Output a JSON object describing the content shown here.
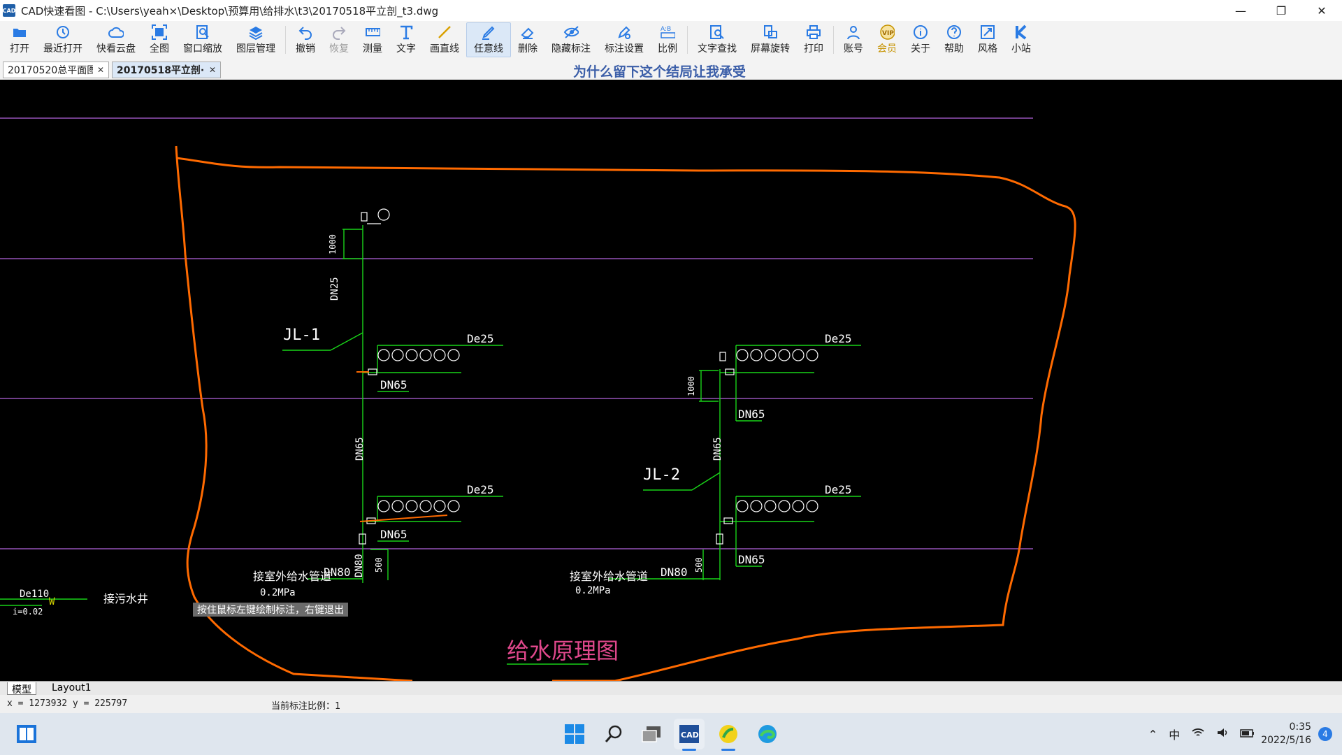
{
  "window": {
    "title": "CAD快速看图 - C:\\Users\\yeah×\\Desktop\\预算用\\给排水\\t3\\20170518平立剖_t3.dwg",
    "icon_text": "CAD"
  },
  "toolbar": {
    "items": [
      {
        "label": "打开",
        "icon": "folder-open-icon"
      },
      {
        "label": "最近打开",
        "icon": "history-icon"
      },
      {
        "label": "快看云盘",
        "icon": "cloud-icon"
      },
      {
        "label": "全图",
        "icon": "fit-all-icon"
      },
      {
        "label": "窗口缩放",
        "icon": "window-zoom-icon"
      },
      {
        "label": "图层管理",
        "icon": "layers-icon"
      },
      {
        "label": "撤销",
        "icon": "undo-icon"
      },
      {
        "label": "恢复",
        "icon": "redo-icon"
      },
      {
        "label": "测量",
        "icon": "ruler-icon"
      },
      {
        "label": "文字",
        "icon": "text-icon"
      },
      {
        "label": "画直线",
        "icon": "line-icon"
      },
      {
        "label": "任意线",
        "icon": "freehand-icon"
      },
      {
        "label": "删除",
        "icon": "eraser-icon"
      },
      {
        "label": "隐藏标注",
        "icon": "eye-icon"
      },
      {
        "label": "标注设置",
        "icon": "annotation-settings-icon"
      },
      {
        "label": "比例",
        "icon": "scale-icon"
      },
      {
        "label": "文字查找",
        "icon": "text-search-icon"
      },
      {
        "label": "屏幕旋转",
        "icon": "rotate-icon"
      },
      {
        "label": "打印",
        "icon": "print-icon"
      },
      {
        "label": "账号",
        "icon": "user-icon"
      },
      {
        "label": "会员",
        "icon": "vip-icon"
      },
      {
        "label": "关于",
        "icon": "info-icon"
      },
      {
        "label": "帮助",
        "icon": "help-icon"
      },
      {
        "label": "风格",
        "icon": "style-icon"
      },
      {
        "label": "小站",
        "icon": "k-icon"
      }
    ],
    "active_item": "任意线",
    "disabled_item": "恢复",
    "vip_badge": "VIP"
  },
  "tabs": [
    {
      "label": "20170520总平面图",
      "active": false
    },
    {
      "label": "20170518平立剖···",
      "active": true
    }
  ],
  "subtitle": "为什么留下这个结局让我承受",
  "drawing": {
    "labels": {
      "jl1": "JL-1",
      "jl2": "JL-2",
      "de25": "De25",
      "dn65": "DN65",
      "dn25": "DN25",
      "dn80": "DN80",
      "dim1000": "1000",
      "dim500": "500",
      "outdoor_pipe": "接室外给水管道",
      "pressure": "0.2MPa",
      "de110": "De110",
      "w": "W",
      "slope": "i=0.02",
      "sewage_well": "接污水井",
      "diagram_title": "给水原理图"
    },
    "colors": {
      "pipe_green": "#19d419",
      "markup_orange": "#ff6a00",
      "floor_line_purple": "#b464dc",
      "text_white": "#ffffff",
      "title_magenta": "#e0488c"
    }
  },
  "tooltip": "按住鼠标左键绘制标注，右键退出",
  "layout_tabs": [
    "模型",
    "Layout1"
  ],
  "status": {
    "coords": "x = 1273932  y = 225797",
    "scale": "当前标注比例：1"
  },
  "taskbar": {
    "apps": [
      "start-icon",
      "search-icon",
      "task-view-icon",
      "cad-app-icon",
      "app-yellow-icon",
      "edge-icon"
    ],
    "tray": {
      "ime": "中",
      "time": "0:35",
      "date": "2022/5/16",
      "notifications": "4"
    }
  }
}
